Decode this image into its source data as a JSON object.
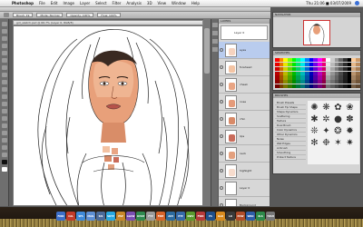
{
  "menubar": {
    "app_name": "Photoshop",
    "items": [
      "File",
      "Edit",
      "Image",
      "Layer",
      "Select",
      "Filter",
      "Analysis",
      "3D",
      "View",
      "Window",
      "Help"
    ],
    "clock": "Thu 21:06 ■ 03/07/2009"
  },
  "app": {
    "workspace_label": "ESSENTIALS WORKSPACE",
    "doc_tab": "girl_sketch.psd @ 66.7% (Layer 0, RGB/8)",
    "zoom": "66.67%",
    "statusbar": "66.67%   Doc: 2.32M/14.8M"
  },
  "options": {
    "field1": "Brush: 19",
    "field2": "Mode: Normal",
    "field3": "Opacity: 100%",
    "field4": "Flow: 100%"
  },
  "layers": {
    "panel_title": "LAYERS",
    "history_label": "Layer 0",
    "rows": [
      {
        "name": "eyes",
        "thumb": "#f6d3bf"
      },
      {
        "name": "forehead",
        "thumb": "#f3c4a4"
      },
      {
        "name": "cheek",
        "thumb": "#e9a584"
      },
      {
        "name": "nose",
        "thumb": "#e59b7a"
      },
      {
        "name": "chin",
        "thumb": "#d88a68"
      },
      {
        "name": "lips",
        "thumb": "#c96b5a"
      },
      {
        "name": "neck",
        "thumb": "#e3a07e"
      },
      {
        "name": "highlight",
        "thumb": "#f7dccd"
      },
      {
        "name": "Layer 0",
        "thumb": "#ffffff"
      },
      {
        "name": "Background",
        "thumb": "#ffffff"
      }
    ]
  },
  "navigator": {
    "title": "NAVIGATOR"
  },
  "swatches": {
    "title": "SWATCHES"
  },
  "brushes": {
    "title": "BRUSHES",
    "presets": [
      "Brush Presets",
      "Brush Tip Shape",
      "Shape Dynamics",
      "Scattering",
      "Texture",
      "Dual Brush",
      "Color Dynamics",
      "Other Dynamics",
      "Noise",
      "Wet Edges",
      "Airbrush",
      "Smoothing",
      "Protect Texture"
    ]
  },
  "dock": {
    "items": [
      {
        "label": "FIND",
        "color": "#3c6fc9"
      },
      {
        "label": "CAL",
        "color": "#c23b2a"
      },
      {
        "label": "SFA",
        "color": "#3f8ad8"
      },
      {
        "label": "MAIL",
        "color": "#5d8fd3"
      },
      {
        "label": "SIS",
        "color": "#4b6b9a"
      },
      {
        "label": "SKYP",
        "color": "#28a8e0"
      },
      {
        "label": "ESP",
        "color": "#c9872a"
      },
      {
        "label": "GLOW",
        "color": "#7a4fb3"
      },
      {
        "label": "ICHAT",
        "color": "#2f8a4f"
      },
      {
        "label": "FTP",
        "color": "#9b9b9b"
      },
      {
        "label": "FIRE",
        "color": "#d8642a"
      },
      {
        "label": "AIM",
        "color": "#2c6a9e"
      },
      {
        "label": "EYE",
        "color": "#356aa8"
      },
      {
        "label": "DWV",
        "color": "#5a9b2e"
      },
      {
        "label": "FWN",
        "color": "#b53a3a"
      },
      {
        "label": "PS",
        "color": "#1e4f8a"
      },
      {
        "label": "ILLU",
        "color": "#d88a1e"
      },
      {
        "label": "LR",
        "color": "#3a3a3a"
      },
      {
        "label": "POW",
        "color": "#b24d2a"
      },
      {
        "label": "WRD",
        "color": "#2d5da8"
      },
      {
        "label": "XLS",
        "color": "#2d8a4a"
      },
      {
        "label": "TRSH",
        "color": "#777777"
      }
    ]
  }
}
